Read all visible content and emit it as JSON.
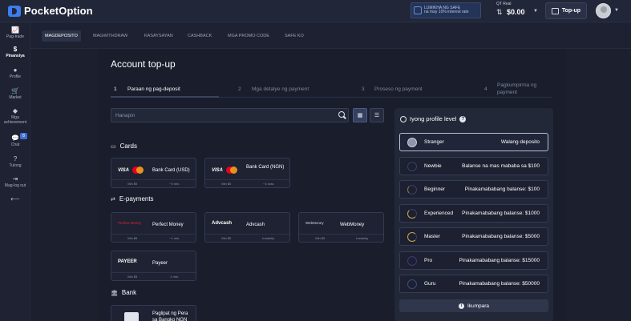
{
  "app": {
    "name": "PocketOption"
  },
  "promo": {
    "line1": "LUMIKHA NG SAFE",
    "line2": "na may 10% interest rate"
  },
  "balance": {
    "label": "QT Real",
    "value": "$0.00"
  },
  "topup": {
    "label": "Top-up"
  },
  "sidebar": {
    "items": [
      {
        "label": "Pag-trade",
        "icon": "chart-icon",
        "glyph": "📈"
      },
      {
        "label": "Pinansiya",
        "icon": "dollar-icon",
        "glyph": "$"
      },
      {
        "label": "Profile",
        "icon": "user-icon",
        "glyph": "●"
      },
      {
        "label": "Market",
        "icon": "cart-icon",
        "glyph": "🛒"
      },
      {
        "label": "Mga achievement",
        "icon": "diamond-icon",
        "glyph": "◆"
      },
      {
        "label": "Chat",
        "icon": "chat-icon",
        "glyph": "💬",
        "badge": "8"
      },
      {
        "label": "Tulong",
        "icon": "help-icon",
        "glyph": "?"
      },
      {
        "label": "Mag-log out",
        "icon": "logout-icon",
        "glyph": "⇥"
      }
    ],
    "collapse_glyph": "⟵"
  },
  "tabs": [
    "MAGDEPOSITO",
    "MAGWITHDRAW",
    "KASAYSAYAN",
    "CASHBACK",
    "MGA PROMO CODE",
    "SAFE KO"
  ],
  "page": {
    "title": "Account top-up"
  },
  "steps": [
    {
      "num": "1",
      "label": "Paraan ng pag-deposit"
    },
    {
      "num": "2",
      "label": "Mga detalye ng payment"
    },
    {
      "num": "3",
      "label": "Proseso ng payment"
    },
    {
      "num": "4",
      "label": "Pagkumpirma ng payment"
    }
  ],
  "search": {
    "placeholder": "Hanapin"
  },
  "sections": {
    "cards": "Cards",
    "epayments": "E-payments",
    "bank": "Bank"
  },
  "methods": {
    "card_usd": {
      "brand": "VISA",
      "name": "Bank Card (USD)",
      "min": "Min $5",
      "time": "~5 min."
    },
    "card_ngn": {
      "brand": "VISA",
      "name": "Bank Card (NGN)",
      "min": "Min $5",
      "time": "~3 oras"
    },
    "perfect_money": {
      "brand": "Perfect Money",
      "name": "Perfect Money",
      "min": "Min $5",
      "time": "~1 min."
    },
    "advcash": {
      "brand": "Advcash",
      "name": "Advcash",
      "min": "Min $5",
      "time": "Instantly"
    },
    "webmoney": {
      "brand": "WebMoney",
      "name": "WebMoney",
      "min": "Min $5",
      "time": "Instantly"
    },
    "payeer": {
      "brand": "PAYEER",
      "name": "Payeer",
      "min": "Min $5",
      "time": "1 min."
    },
    "bank_ngn": {
      "name": "Paglipat ng Pera sa Bangko NGN"
    }
  },
  "levels": {
    "title": "Iyong profile level",
    "rows": [
      {
        "name": "Stranger",
        "req": "Walang deposito",
        "current": true
      },
      {
        "name": "Newbie",
        "req": "Balanse na mas mababa sa $100",
        "current": false
      },
      {
        "name": "Beginner",
        "req": "Pinakamababang balanse: $100",
        "current": false
      },
      {
        "name": "Experienced",
        "req": "Pinakamababang balanse: $1000",
        "current": false
      },
      {
        "name": "Master",
        "req": "Pinakamababang balanse: $5000",
        "current": false
      },
      {
        "name": "Pro",
        "req": "Pinakamababang balanse: $15000",
        "current": false
      },
      {
        "name": "Guru",
        "req": "Pinakamababang balanse: $50000",
        "current": false
      }
    ],
    "compare_label": "Ikumpara"
  },
  "colors": {
    "accent": "#3c7df0",
    "background": "#1b1f2e",
    "panel": "#232839"
  }
}
